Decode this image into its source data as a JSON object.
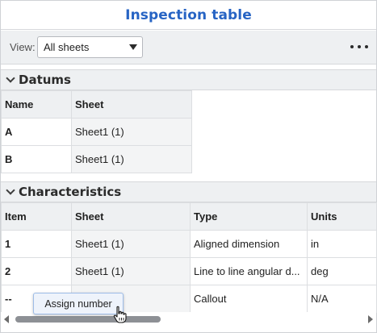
{
  "panel": {
    "title": "Inspection table"
  },
  "toolbar": {
    "view_label": "View:",
    "view_value": "All sheets",
    "more_icon": "more-horizontal-icon"
  },
  "datums": {
    "title": "Datums",
    "headers": [
      "Name",
      "Sheet"
    ],
    "rows": [
      [
        "A",
        "Sheet1 (1)"
      ],
      [
        "B",
        "Sheet1 (1)"
      ]
    ]
  },
  "characteristics": {
    "title": "Characteristics",
    "headers": [
      "Item",
      "Sheet",
      "Type",
      "Units"
    ],
    "rows": [
      [
        "1",
        "Sheet1 (1)",
        "Aligned dimension",
        "in"
      ],
      [
        "2",
        "Sheet1 (1)",
        "Line to line angular d...",
        "deg"
      ],
      [
        "--",
        "",
        "Callout",
        "N/A"
      ]
    ]
  },
  "context_action": {
    "label": "Assign number"
  },
  "colors": {
    "accent": "#2764c4",
    "header_bg": "#eef0f2",
    "border": "#dcdee1"
  }
}
